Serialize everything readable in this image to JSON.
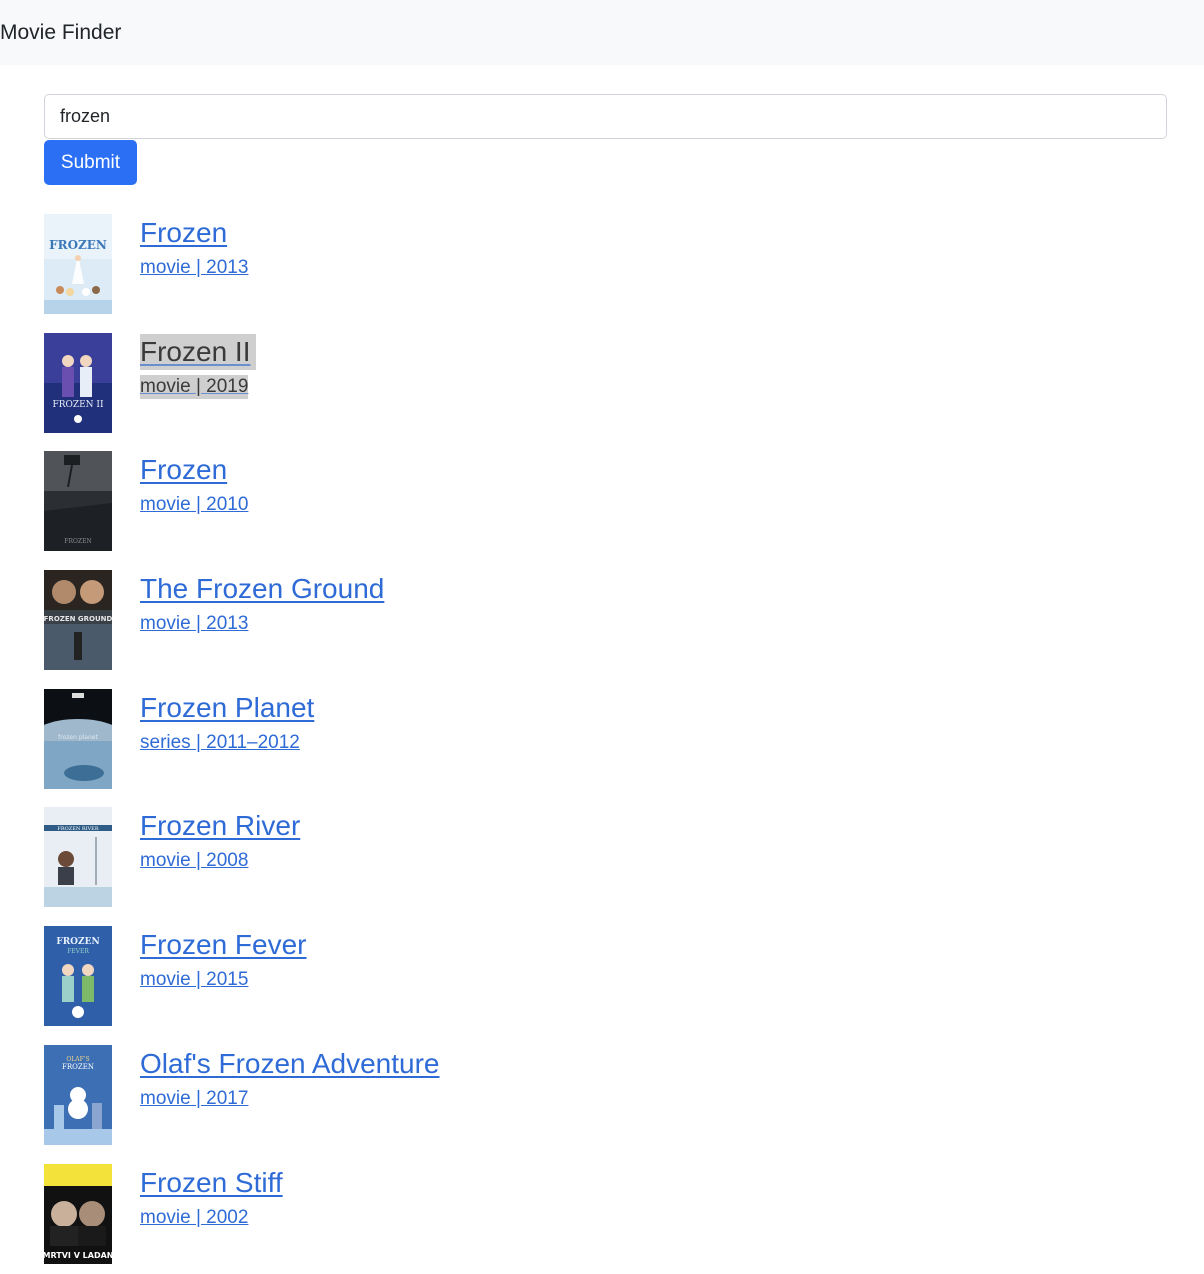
{
  "navbar": {
    "brand": "Movie Finder"
  },
  "search": {
    "value": "frozen",
    "submit_label": "Submit"
  },
  "results": [
    {
      "title": "Frozen",
      "meta": "movie | 2013",
      "poster_icon": "frozen-2013-poster",
      "poster_colors": [
        "#dcebf5",
        "#6fa7d6"
      ]
    },
    {
      "title": "Frozen II",
      "meta": "movie | 2019",
      "poster_icon": "frozen-ii-poster",
      "poster_colors": [
        "#1a2a6c",
        "#6b4fb0"
      ],
      "selected": true
    },
    {
      "title": "Frozen",
      "meta": "movie | 2010",
      "poster_icon": "frozen-2010-poster",
      "poster_colors": [
        "#2b2f33",
        "#6c7075"
      ]
    },
    {
      "title": "The Frozen Ground",
      "meta": "movie | 2013",
      "poster_icon": "frozen-ground-poster",
      "poster_colors": [
        "#2a2520",
        "#4a5a6a"
      ]
    },
    {
      "title": "Frozen Planet",
      "meta": "series | 2011–2012",
      "poster_icon": "frozen-planet-poster",
      "poster_colors": [
        "#0c0f14",
        "#7fa6c4"
      ]
    },
    {
      "title": "Frozen River",
      "meta": "movie | 2008",
      "poster_icon": "frozen-river-poster",
      "poster_colors": [
        "#e8eef3",
        "#2e5c86"
      ]
    },
    {
      "title": "Frozen Fever",
      "meta": "movie | 2015",
      "poster_icon": "frozen-fever-poster",
      "poster_colors": [
        "#2f5fa8",
        "#9ad0c9"
      ]
    },
    {
      "title": "Olaf's Frozen Adventure",
      "meta": "movie | 2017",
      "poster_icon": "olafs-frozen-adventure-poster",
      "poster_colors": [
        "#3c6fb4",
        "#a7c8e8"
      ]
    },
    {
      "title": "Frozen Stiff",
      "meta": "movie | 2002",
      "poster_icon": "frozen-stiff-poster",
      "poster_colors": [
        "#f2e23a",
        "#111111"
      ]
    }
  ],
  "colors": {
    "link": "#2f6bd6",
    "button": "#2b6ff4",
    "navbar_bg": "#f8f9fa"
  }
}
